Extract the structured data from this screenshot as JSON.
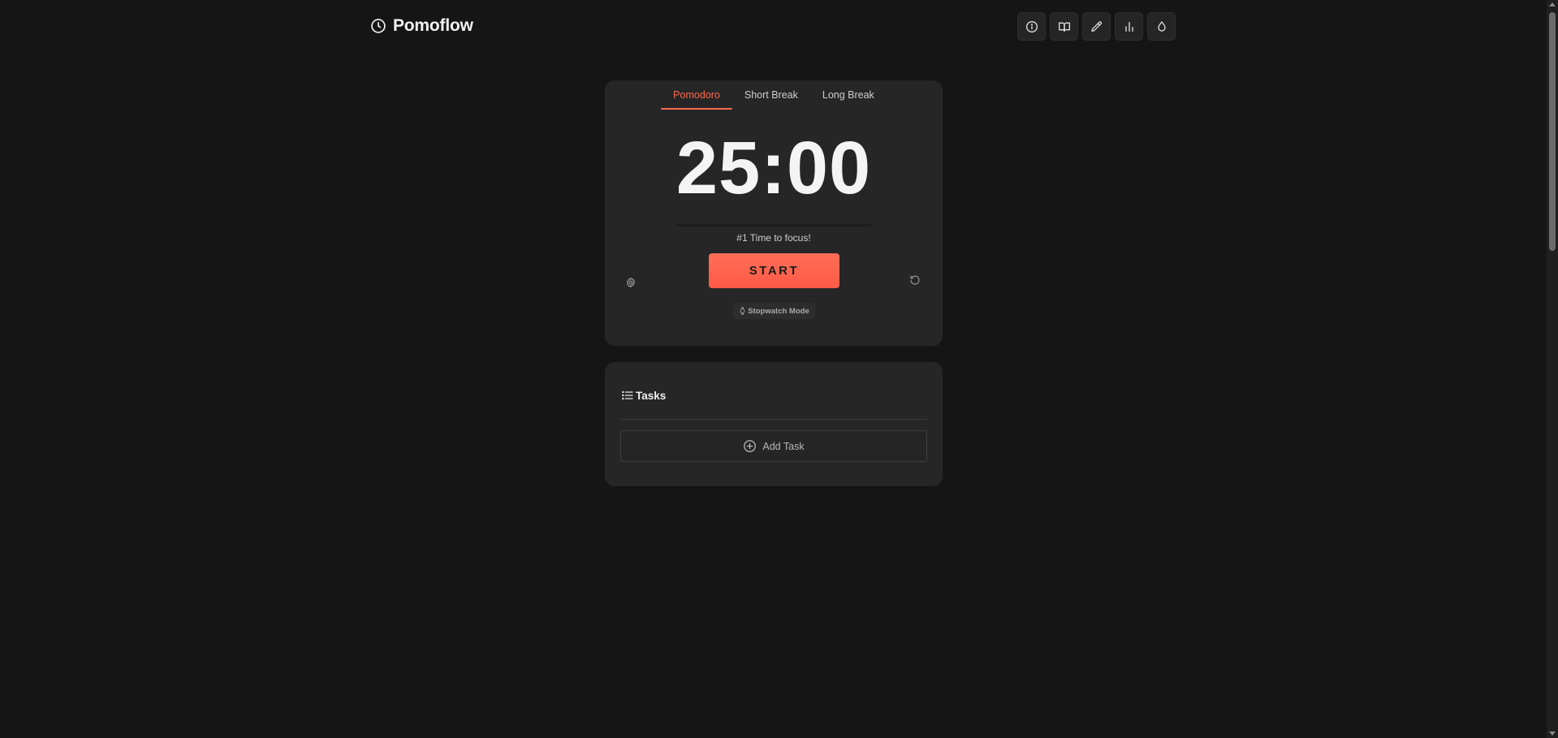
{
  "header": {
    "brand_name": "Pomoflow",
    "toolbar": [
      {
        "name": "info",
        "icon": "info-icon"
      },
      {
        "name": "guide",
        "icon": "book-icon"
      },
      {
        "name": "notes",
        "icon": "pencil-icon"
      },
      {
        "name": "stats",
        "icon": "bar-chart-icon"
      },
      {
        "name": "theme",
        "icon": "droplet-icon"
      }
    ]
  },
  "timer": {
    "tabs": [
      {
        "label": "Pomodoro",
        "active": true
      },
      {
        "label": "Short Break",
        "active": false
      },
      {
        "label": "Long Break",
        "active": false
      }
    ],
    "time": "25:00",
    "progress": 0,
    "message": "#1 Time to focus!",
    "start_label": "START",
    "stopwatch_label": "Stopwatch Mode"
  },
  "tasks": {
    "title": "Tasks",
    "add_label": "Add Task"
  },
  "colors": {
    "accent": "#ff6a4f",
    "background": "#151515",
    "card": "#262626"
  }
}
